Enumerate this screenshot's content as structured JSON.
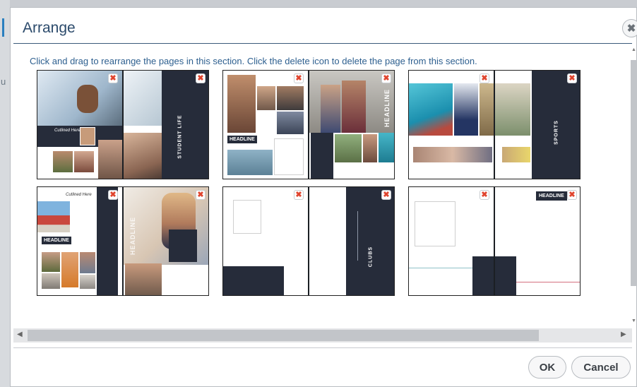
{
  "dialog": {
    "title": "Arrange",
    "close_symbol": "✖",
    "instructions": "Click and drag to rearrange the pages in this section. Click the delete icon to delete the page from this section."
  },
  "backdrop": {
    "letter": "u"
  },
  "spreads": [
    {
      "label": "STUDENT LIFE",
      "script_text": "Cutlined Here"
    },
    {
      "label": "HEADLINE",
      "sub_label": "HEADLINE"
    },
    {
      "label": "SPORTS"
    },
    {
      "label": "HEADLINE",
      "sub_label": "HEADLINE",
      "script_text": "Cutlined Here"
    },
    {
      "label": "CLUBS"
    },
    {
      "label": "HEADLINE"
    }
  ],
  "delete_icon": {
    "symbol": "✖"
  },
  "buttons": {
    "ok": "OK",
    "cancel": "Cancel"
  },
  "scroll": {
    "up": "▲",
    "down": "▼",
    "left": "◀",
    "right": "▶"
  },
  "colors": {
    "title": "#2b4a6b",
    "instructions": "#2d5f8f",
    "navy": "#262c3a",
    "delete": "#e0452f"
  }
}
